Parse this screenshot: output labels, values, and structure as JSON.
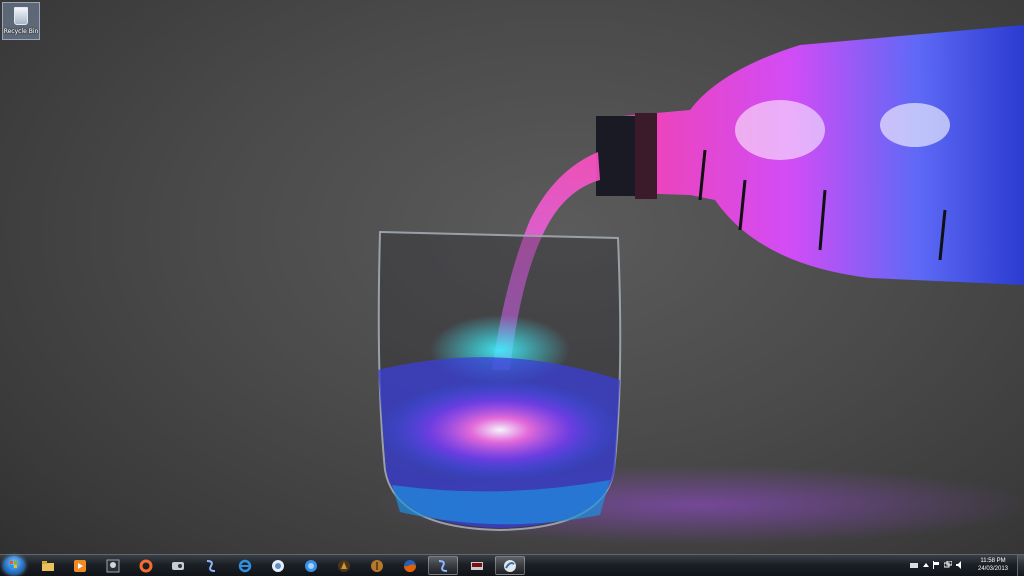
{
  "desktop": {
    "icons": [
      {
        "label": "Recycle Bin",
        "icon": "recycle-bin-icon"
      }
    ],
    "wallpaper": "galaxy-bottle-pouring-into-glass"
  },
  "taskbar": {
    "start_icon": "windows-start-orb-icon",
    "apps": [
      {
        "name": "windows-explorer",
        "icon": "folder-icon",
        "color": "#e8c15a"
      },
      {
        "name": "media-player",
        "icon": "media-player-icon",
        "color": "#f08a24"
      },
      {
        "name": "game-app",
        "icon": "game-icon",
        "color": "#9aa4ad"
      },
      {
        "name": "origin",
        "icon": "origin-icon",
        "color": "#f56c2d"
      },
      {
        "name": "steam",
        "icon": "steam-icon",
        "color": "#c7ccd1"
      },
      {
        "name": "starcraft",
        "icon": "starcraft-icon",
        "color": "#8fb7ff"
      },
      {
        "name": "internet-explorer",
        "icon": "internet-explorer-icon",
        "color": "#2f8fe0"
      },
      {
        "name": "chat-app",
        "icon": "chat-icon",
        "color": "#e8eef5"
      },
      {
        "name": "blue-app",
        "icon": "globe-icon",
        "color": "#3b8fe5"
      },
      {
        "name": "league-launcher",
        "icon": "game-launcher-icon",
        "color": "#c89a3b"
      },
      {
        "name": "other-app",
        "icon": "brown-app-icon",
        "color": "#b5782d"
      },
      {
        "name": "firefox",
        "icon": "firefox-icon",
        "color": "#e66000"
      },
      {
        "name": "starcraft-running",
        "icon": "starcraft-icon",
        "color": "#8fb7ff",
        "active": true
      },
      {
        "name": "video-app",
        "icon": "video-icon",
        "color": "#cccccc"
      },
      {
        "name": "browser-app",
        "icon": "browser-icon",
        "color": "#e0e6ee",
        "active": true
      }
    ],
    "tray": {
      "icons": [
        "keyboard-icon",
        "up-arrow-icon",
        "flag-icon",
        "network-icon",
        "volume-icon"
      ],
      "time": "11:58 PM",
      "date": "24/03/2013"
    }
  }
}
